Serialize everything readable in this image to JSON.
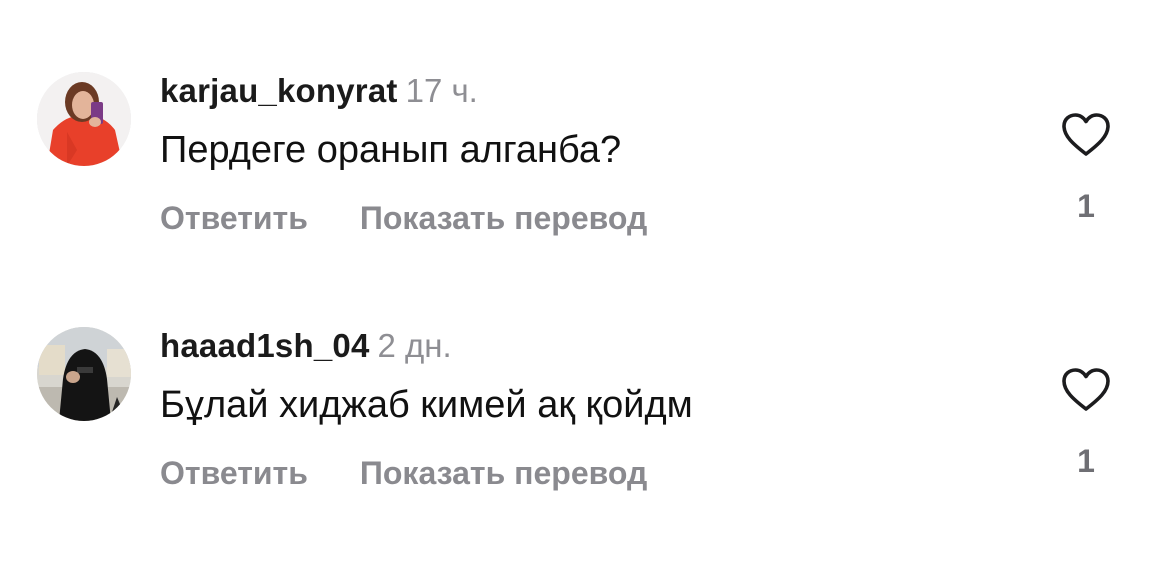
{
  "comments": [
    {
      "username": "karjau_konyrat",
      "time": "17 ч.",
      "text": "Пердеге оранып алганба?",
      "reply_label": "Ответить",
      "translate_label": "Показать перевод",
      "likes": "1"
    },
    {
      "username": "haaad1sh_04",
      "time": "2 дн.",
      "text": "Бұлай хиджаб кимей ақ қойдм",
      "reply_label": "Ответить",
      "translate_label": "Показать перевод",
      "likes": "1"
    }
  ],
  "colors": {
    "username": "#1b1b1b",
    "secondary": "#8e8e93",
    "action": "#8a8a8f",
    "heart_stroke": "#1c1c1e"
  },
  "icons": [
    "heart-icon"
  ]
}
